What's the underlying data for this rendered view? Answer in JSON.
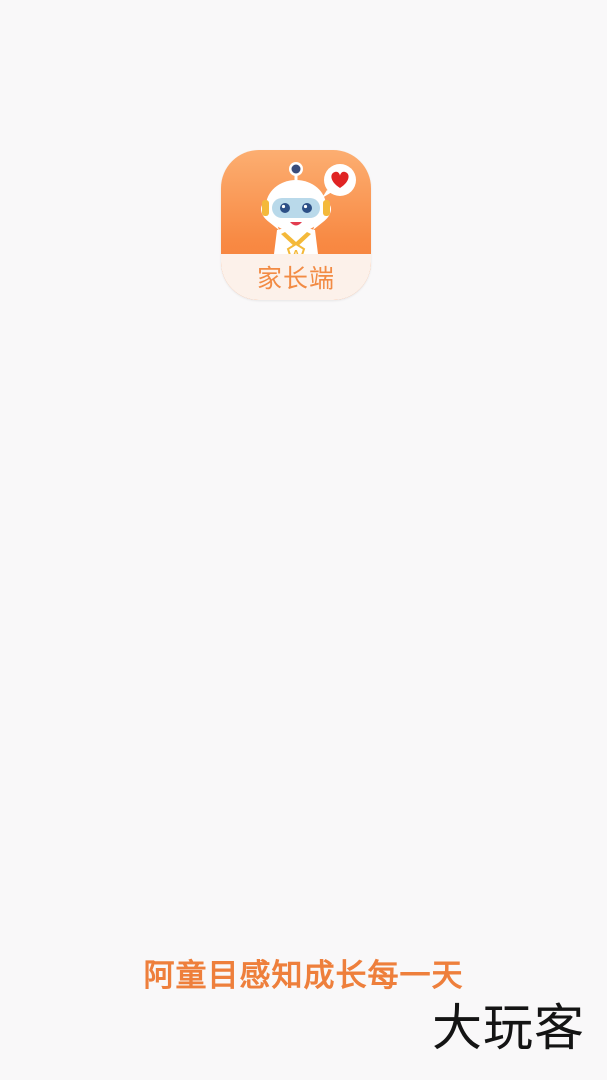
{
  "app_icon": {
    "label": "家长端",
    "icon_name": "robot-mascot-icon",
    "accent_color": "#f88a44",
    "label_color": "#f28b44"
  },
  "splash": {
    "slogan": "阿童目感知成长每一天",
    "slogan_color": "#ee7f3c"
  },
  "watermark": {
    "text": "大玩客"
  }
}
